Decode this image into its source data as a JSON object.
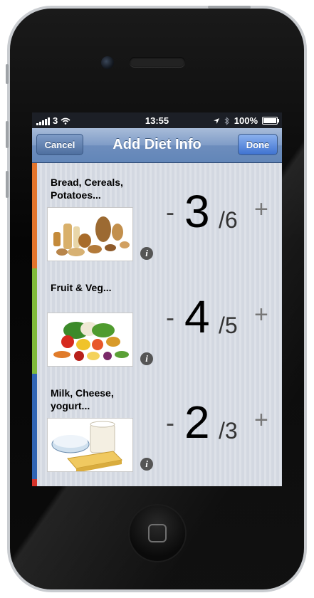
{
  "status_bar": {
    "carrier": "3",
    "time": "13:55",
    "battery": "100%",
    "icons": [
      "signal-bars-icon",
      "wifi-icon",
      "location-arrow-icon",
      "bluetooth-icon",
      "battery-icon"
    ]
  },
  "nav": {
    "title": "Add Diet Info",
    "cancel_label": "Cancel",
    "done_label": "Done"
  },
  "rows": [
    {
      "label": "Bread, Cereals, Potatoes...",
      "current": "3",
      "target": "/6",
      "minus": "-",
      "plus": "+",
      "color": "#e2742c",
      "image": "bread-cereals-photo"
    },
    {
      "label": "Fruit & Veg...",
      "current": "4",
      "target": "/5",
      "minus": "-",
      "plus": "+",
      "color": "#7fba3a",
      "image": "fruit-veg-photo"
    },
    {
      "label": "Milk, Cheese, yogurt...",
      "current": "2",
      "target": "/3",
      "minus": "-",
      "plus": "+",
      "color": "#2f64b4",
      "image": "dairy-photo"
    }
  ],
  "info_glyph": "i"
}
